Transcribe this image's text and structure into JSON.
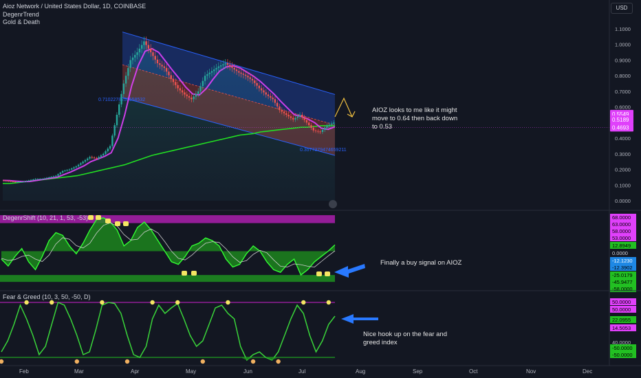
{
  "header": {
    "title": "Aioz Network / United States Dollar, 1D, COINBASE",
    "indicators": [
      "DegenrTrend",
      "Gold & Death"
    ],
    "currency": "USD"
  },
  "annotations": {
    "main": "AIOZ looks to me like it might move to 0.64 then back down to 0.53",
    "shift": "Finally a buy signal on AIOZ",
    "fear": "Nice hook up on the fear and greed index"
  },
  "panes": {
    "shift_title": "DegenrShift (10, 21, 1, 53, -53)",
    "fear_title": "Fear & Greed (10, 3, 50, -50, D)"
  },
  "colors": {
    "background": "#131722",
    "green": "#22e022",
    "magenta": "#e040fb",
    "red": "#ef5350",
    "channel": "#2962ff",
    "arrow": "#2979ff",
    "yellow_arrow": "#f0c040"
  },
  "chart_data": [
    {
      "type": "line",
      "title": "Aioz Network / United States Dollar, 1D, COINBASE",
      "x_labels": [
        "Feb",
        "Mar",
        "Apr",
        "May",
        "Jun",
        "Jul",
        "Aug",
        "Sep",
        "Oct",
        "Nov",
        "Dec"
      ],
      "y_ticks": [
        1.1,
        1.0,
        0.9,
        0.8,
        0.7,
        0.6,
        0.5,
        0.4,
        0.3,
        0.2,
        0.1,
        0.0
      ],
      "y_tick_labels": [
        "1.1000",
        "1.0000",
        "0.9000",
        "0.8000",
        "0.7000",
        "0.6000",
        "0.5000",
        "0.4000",
        "0.3000",
        "0.2000",
        "0.1000",
        "0.0000"
      ],
      "ylim": [
        0.0,
        1.1
      ],
      "price_labels": [
        {
          "value": 0.5549,
          "text": "0.5549",
          "color": "#e040fb"
        },
        {
          "value": 0.5189,
          "text": "0.5189",
          "color": "#e040fb"
        },
        {
          "value": 0.4693,
          "text": "0.4693",
          "color": "#e040fb"
        }
      ],
      "channel_labels": [
        "0.7102278255658532",
        "0.3577379474659211"
      ],
      "series": [
        {
          "values": [
            0.13,
            0.125,
            0.12,
            0.12,
            0.13,
            0.14,
            0.14,
            0.15,
            0.16,
            0.19,
            0.2,
            0.22,
            0.25,
            0.28,
            0.27,
            0.3,
            0.35,
            0.55,
            0.75,
            0.9,
            0.95,
            1.02,
            0.95,
            0.88,
            0.85,
            0.78,
            0.72,
            0.68,
            0.65,
            0.7,
            0.8,
            0.83,
            0.86,
            0.88,
            0.85,
            0.82,
            0.8,
            0.77,
            0.72,
            0.68,
            0.65,
            0.58,
            0.55,
            0.52,
            0.55,
            0.5,
            0.45,
            0.44,
            0.48,
            0.5
          ]
        },
        {
          "values": [
            0.11,
            0.11,
            0.115,
            0.12,
            0.125,
            0.13,
            0.135,
            0.14,
            0.145,
            0.15,
            0.155,
            0.16,
            0.17,
            0.18,
            0.19,
            0.2,
            0.21,
            0.22,
            0.23,
            0.245,
            0.26,
            0.275,
            0.29,
            0.3,
            0.31,
            0.32,
            0.33,
            0.34,
            0.35,
            0.36,
            0.37,
            0.38,
            0.39,
            0.4,
            0.41,
            0.42,
            0.425,
            0.43,
            0.44,
            0.445,
            0.45,
            0.455,
            0.46,
            0.465,
            0.47,
            0.47,
            0.475,
            0.48,
            0.48,
            0.48
          ]
        }
      ]
    },
    {
      "type": "area",
      "title": "DegenrShift (10, 21, 1, 53, -53)",
      "y_tick_labels": [
        "68.0000",
        "63.0000",
        "58.0000",
        "53.0000",
        "12.8949",
        "0.0000",
        "-12.1230",
        "-12.3902",
        "-25.0179",
        "-45.9477",
        "-58.0000"
      ],
      "ylim": [
        -63,
        72
      ],
      "values": [
        -15,
        -28,
        -10,
        5,
        -20,
        -35,
        -10,
        20,
        35,
        30,
        10,
        -5,
        15,
        40,
        60,
        63,
        55,
        40,
        10,
        20,
        45,
        55,
        40,
        20,
        0,
        -20,
        -25,
        -10,
        10,
        15,
        25,
        20,
        10,
        -15,
        -30,
        -25,
        -5,
        10,
        0,
        -20,
        -35,
        -40,
        -25,
        -15,
        -45,
        -35,
        -20,
        -10,
        0,
        12
      ]
    },
    {
      "type": "line",
      "title": "Fear & Greed (10, 3, 50, -50, D)",
      "y_tick_labels": [
        "50.0000",
        "50.0000",
        "22.0955",
        "14.5053",
        "40.0000",
        "-50.0000",
        "-50.0000"
      ],
      "ylim": [
        -60,
        60
      ],
      "values": [
        -40,
        -20,
        10,
        45,
        20,
        -10,
        -45,
        -30,
        10,
        50,
        45,
        20,
        -10,
        -45,
        -40,
        0,
        45,
        50,
        48,
        30,
        -10,
        -45,
        -50,
        -30,
        20,
        45,
        30,
        40,
        48,
        20,
        -10,
        -30,
        -20,
        10,
        40,
        45,
        30,
        20,
        -30,
        -55,
        -45,
        -40,
        -50,
        -55,
        -40,
        -10,
        20,
        45,
        30,
        -10,
        -40,
        -20,
        10,
        25
      ]
    }
  ]
}
